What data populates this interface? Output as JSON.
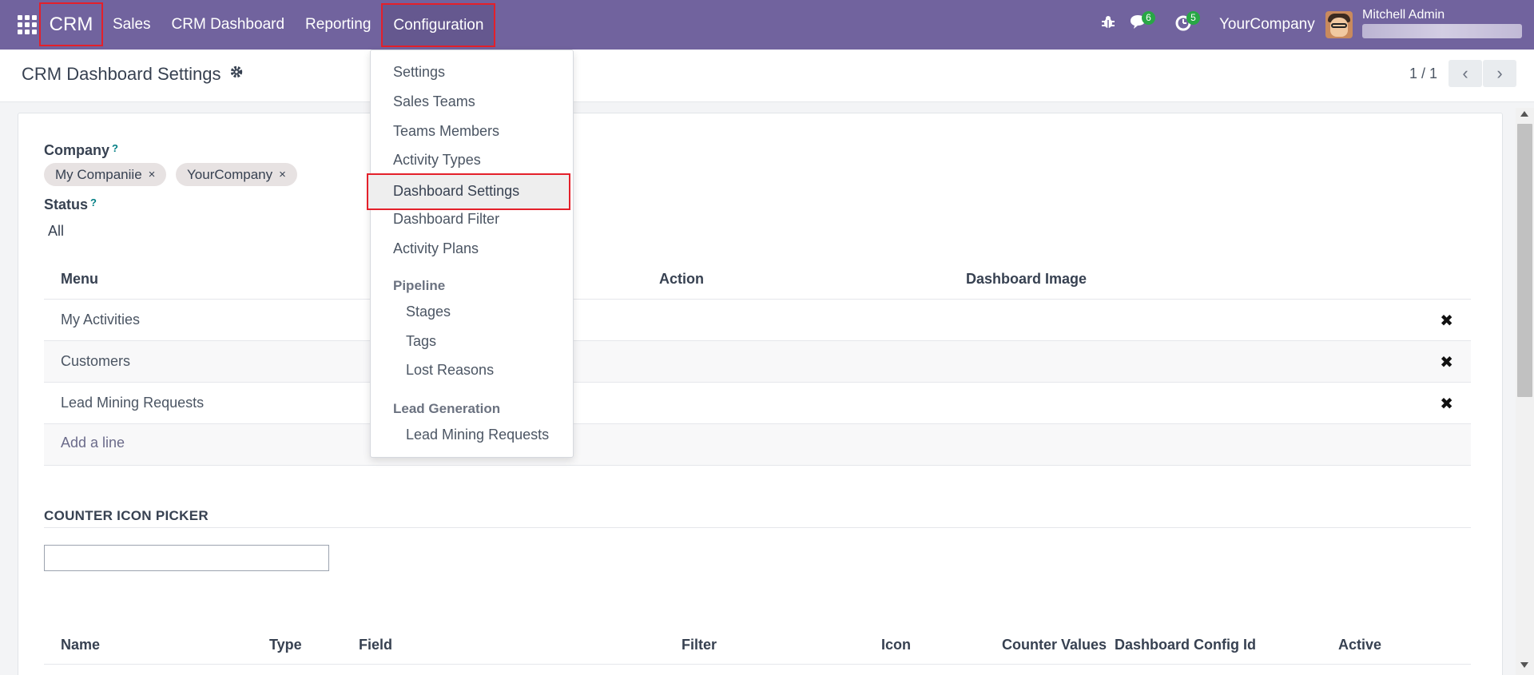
{
  "topbar": {
    "app_name": "CRM",
    "menus": [
      "Sales",
      "CRM Dashboard",
      "Reporting",
      "Configuration"
    ],
    "messages_count": "6",
    "activities_count": "5",
    "company": "YourCompany",
    "user_name": "Mitchell Admin",
    "colors": {
      "bar": "#71639e",
      "highlight": "#e4202a",
      "badge": "#28a745"
    }
  },
  "control_panel": {
    "title": "CRM Dashboard Settings",
    "pager": "1 / 1"
  },
  "form": {
    "company_label": "Company",
    "company_help": "?",
    "companies": [
      "My Companiie",
      "YourCompany"
    ],
    "status_label": "Status",
    "status_help": "?",
    "status_value": "All",
    "menu_table": {
      "headers": [
        "Menu",
        "Action",
        "Dashboard Image"
      ],
      "rows": [
        "My Activities",
        "Customers",
        "Lead Mining Requests"
      ],
      "add_line": "Add a line"
    },
    "counter_section": "COUNTER ICON PICKER",
    "counter_input_value": "",
    "counter_table": {
      "headers": [
        "Name",
        "Type",
        "Field",
        "Filter",
        "Icon",
        "Counter Values",
        "Dashboard Config Id",
        "Active"
      ]
    }
  },
  "config_menu": {
    "items": [
      "Settings",
      "Sales Teams",
      "Teams Members",
      "Activity Types",
      "Dashboard Settings",
      "Dashboard Filter",
      "Activity Plans"
    ],
    "active_item": "Dashboard Settings",
    "pipeline_group": "Pipeline",
    "pipeline_items": [
      "Stages",
      "Tags",
      "Lost Reasons"
    ],
    "lead_group": "Lead Generation",
    "lead_items": [
      "Lead Mining Requests"
    ]
  }
}
